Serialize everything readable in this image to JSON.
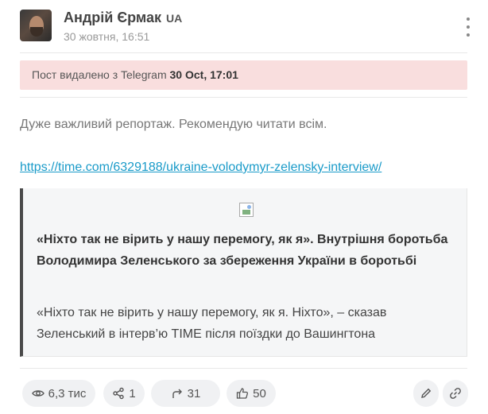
{
  "header": {
    "channel_name": "Андрій Єрмак",
    "lang_badge": "UA",
    "date": "30 жовтня, 16:51"
  },
  "deleted_banner": {
    "prefix": "Пост видалено з Telegram",
    "timestamp": "30 Oct, 17:01"
  },
  "post": {
    "text": "Дуже важливий репортаж. Рекомендую читати всім.",
    "link": "https://time.com/6329188/ukraine-volodymyr-zelensky-interview/"
  },
  "preview": {
    "title": "«Ніхто так не вірить у нашу перемогу, як я». Внутрішня боротьба Володимира Зеленського за збереження України в боротьбі",
    "description": "«Ніхто так не вірить у нашу перемогу, як я. Ніхто», – сказав Зеленський в інтерв’ю TIME після поїздки до Вашингтона"
  },
  "stats": {
    "views": "6,3 тис",
    "shares": "1",
    "forwards": "31",
    "reactions": "50"
  },
  "icons": {
    "views": "eye-icon",
    "shares": "share-icon",
    "forwards": "forward-icon",
    "reactions": "thumbs-up-icon",
    "edit": "pencil-icon",
    "link": "link-icon",
    "menu": "vertical-dots-icon"
  }
}
